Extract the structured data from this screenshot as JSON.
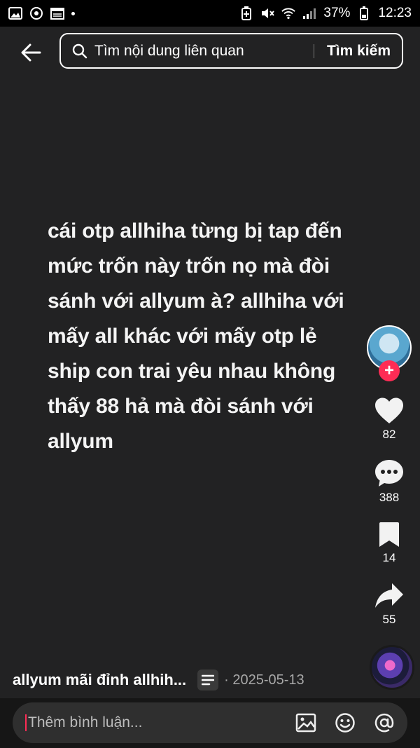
{
  "status_bar": {
    "battery": "37%",
    "time": "12:23",
    "icons": [
      "gallery-icon",
      "sync-icon",
      "calendar-icon",
      "notification-dot",
      "battery-saver-icon",
      "mute-icon",
      "wifi-icon",
      "signal-icon"
    ]
  },
  "search": {
    "placeholder": "Tìm nội dung liên quan",
    "button_label": "Tìm kiếm"
  },
  "post": {
    "text": "cái otp allhiha từng bị tap đến mức trốn này trốn nọ mà đòi sánh với allyum à? allhiha với mấy all khác với mấy otp lẻ ship con trai yêu nhau không thấy 88 hả mà đòi sánh với allyum"
  },
  "actions": {
    "likes": "82",
    "comments": "388",
    "saves": "14",
    "shares": "55"
  },
  "caption": {
    "author": "allyum mãi đỉnh allhih...",
    "date": "· 2025-05-13"
  },
  "comment_bar": {
    "placeholder": "Thêm bình luận..."
  },
  "colors": {
    "accent": "#fe2c55",
    "stage_bg": "#222223"
  }
}
